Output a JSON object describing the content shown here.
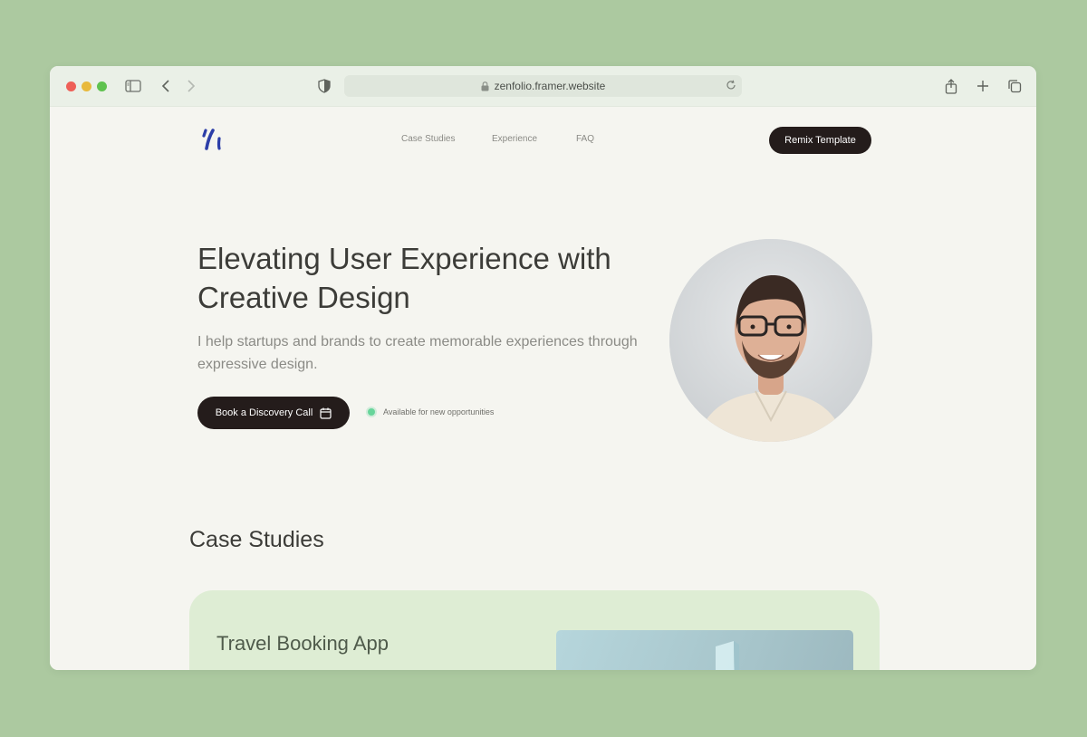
{
  "browser": {
    "url": "zenfolio.framer.website"
  },
  "nav": {
    "links": [
      "Case Studies",
      "Experience",
      "FAQ"
    ],
    "remix_label": "Remix Template"
  },
  "hero": {
    "title": "Elevating User Experience with Creative Design",
    "subtitle": "I help startups and brands to create memorable experiences through expressive design.",
    "cta_label": "Book a Discovery Call",
    "availability": "Available for new opportunities"
  },
  "case_studies": {
    "heading": "Case Studies",
    "cards": [
      {
        "title": "Travel Booking App"
      }
    ]
  },
  "colors": {
    "page_bg": "#acc9a0",
    "accent_dark": "#241c1b",
    "logo_blue": "#2c3ea8",
    "available_green": "#67d59a",
    "card_bg": "#deedd4"
  },
  "icons": {
    "logo": "brand-mark-icon",
    "cta": "calendar-icon"
  }
}
